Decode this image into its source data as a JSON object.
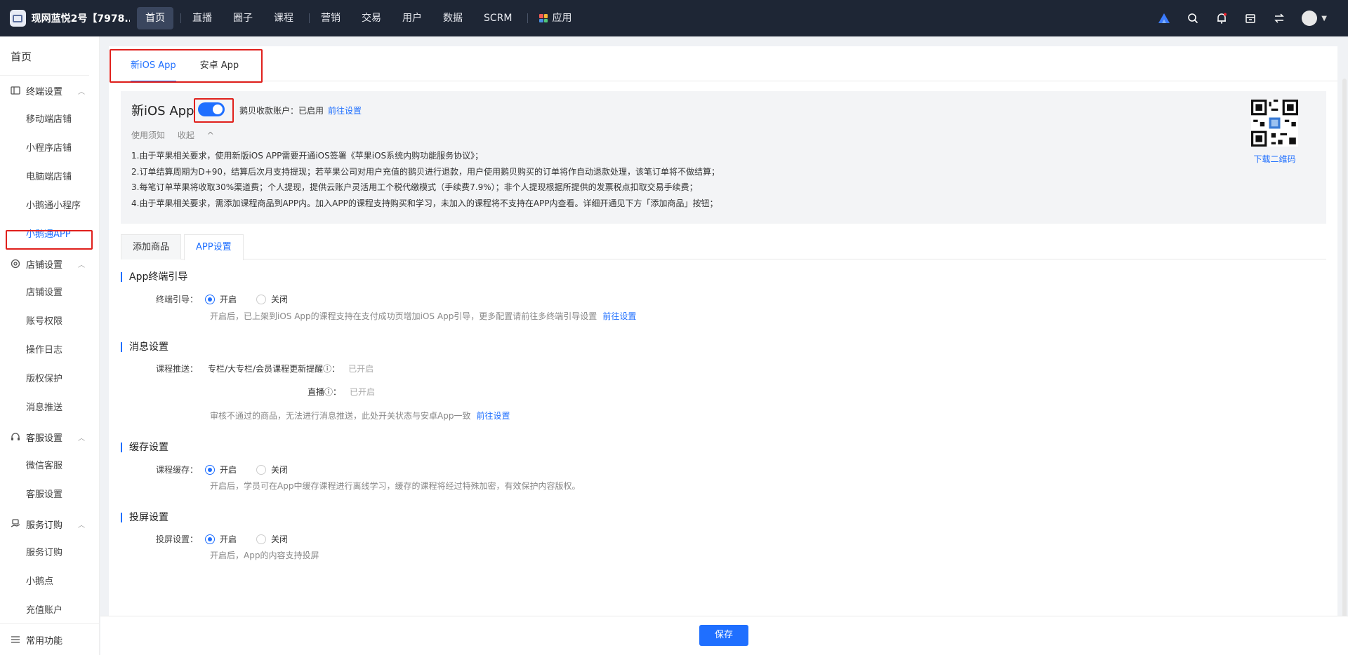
{
  "topbar": {
    "brand": "现网蓝悦2号【7978...",
    "nav": [
      "首页",
      "直播",
      "圈子",
      "课程",
      "营销",
      "交易",
      "用户",
      "数据",
      "SCRM"
    ],
    "apps_label": "应用"
  },
  "sidebar": {
    "home": "首页",
    "groups": [
      {
        "label": "终端设置",
        "items": [
          "移动端店铺",
          "小程序店铺",
          "电脑端店铺",
          "小鹅通小程序",
          "小鹅通APP"
        ]
      },
      {
        "label": "店铺设置",
        "items": [
          "店铺设置",
          "账号权限",
          "操作日志",
          "版权保护",
          "消息推送"
        ]
      },
      {
        "label": "客服设置",
        "items": [
          "微信客服",
          "客服设置"
        ]
      },
      {
        "label": "服务订购",
        "items": [
          "服务订购",
          "小鹅点",
          "充值账户"
        ]
      }
    ],
    "bottom": "常用功能"
  },
  "tabs_top": [
    "新iOS App",
    "安卓 App"
  ],
  "info": {
    "title": "新iOS App",
    "account_label": "鹅贝收款账户：已启用",
    "account_link": "前往设置",
    "notice": "使用须知",
    "collapse": "收起",
    "lines": [
      "1.由于苹果相关要求，使用新版iOS APP需要开通iOS签署《苹果iOS系统内购功能服务协议》；",
      "2.订单结算周期为D+90，结算后次月支持提现；若苹果公司对用户充值的鹅贝进行退款，用户使用鹅贝购买的订单将作自动退款处理，该笔订单将不做结算；",
      "3.每笔订单苹果将收取30%渠道费；个人提现，提供云账户灵活用工个税代缴模式（手续费7.9%）；非个人提现根据所提供的发票税点扣取交易手续费；",
      "4.由于苹果相关要求，需添加课程商品到APP内。加入APP的课程支持购买和学习，未加入的课程将不支持在APP内查看。详细开通见下方「添加商品」按钮；"
    ],
    "qr_link": "下载二维码"
  },
  "tabs_card": [
    "添加商品",
    "APP设置"
  ],
  "sections": {
    "guide": {
      "title": "App终端引导",
      "label": "终端引导：",
      "on": "开启",
      "off": "关闭",
      "desc": "开启后，已上架到iOS App的课程支持在支付成功页增加iOS App引导，更多配置请前往多终端引导设置",
      "link": "前往设置"
    },
    "message": {
      "title": "消息设置",
      "label": "课程推送：",
      "item1": "专栏/大专栏/会员课程更新提醒ⓘ：",
      "item1_val": "已开启",
      "item2": "直播ⓘ：",
      "item2_val": "已开启",
      "desc": "审核不通过的商品，无法进行消息推送，此处开关状态与安卓App一致",
      "link": "前往设置"
    },
    "cache": {
      "title": "缓存设置",
      "label": "课程缓存：",
      "on": "开启",
      "off": "关闭",
      "desc": "开启后，学员可在App中缓存课程进行离线学习，缓存的课程将经过特殊加密，有效保护内容版权。"
    },
    "cast": {
      "title": "投屏设置",
      "label": "投屏设置：",
      "on": "开启",
      "off": "关闭",
      "desc": "开启后，App的内容支持投屏"
    }
  },
  "footer": {
    "save": "保存"
  }
}
